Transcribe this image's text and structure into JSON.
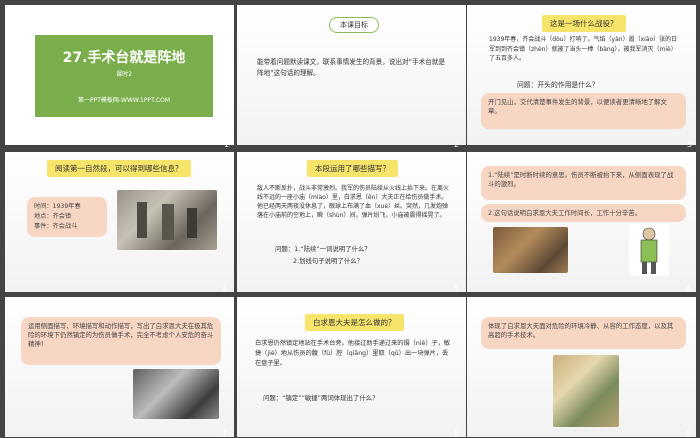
{
  "slides": [
    {
      "id": 1,
      "number": "1",
      "title": "27.手术台就是阵地",
      "subtitle": "课时2",
      "footer": "第一PPT模板网-WWW.1PPT.COM"
    },
    {
      "id": 2,
      "number": "2",
      "pill": "本课目标",
      "text": "能带着问题默读课文，联系事情发生的背景，说出对“手术台就是阵地”这句话的理解。"
    },
    {
      "id": 3,
      "number": "3",
      "pill": "这是一场什么战役？",
      "text": "1939年春，齐会战斗（dòu）打响了。气焰（yàn）嚣（xiāo）张的日军到到齐会镇（zhèn）就被了当头一棒（bàng），被我军消灭（miè）了五百多人。",
      "question": "问题：开头的作用是什么？",
      "answer": "开门见山，交代清楚事件发生的背景，以便读者更清晰地了解文章。"
    },
    {
      "id": 4,
      "number": "4",
      "pill": "阅读第一自然段，可以得到哪些信息？",
      "info": [
        "时间：1939年春",
        "地点：齐会镇",
        "事件：齐会战斗"
      ]
    },
    {
      "id": 5,
      "number": "5",
      "pill": "本段运用了哪些描写？",
      "text": "敌人不断反扑，战斗非常激烈。我军的伤员陆续从火线上抬下来。在离火线不远的一座小庙（miào）里，白求恩（ēn）大夫正在给伤员做手术。他已经两天两夜没休息了，眼球上布满了血（xuè）丝。突然，几发炮弹落在小庙前的空地上，瞬（shùn）间，弹片纷飞，小庙被震得摇晃了。",
      "q1": "问题：1.“陆续”一词说明了什么？",
      "q2": "2.划线句子说明了什么？"
    },
    {
      "id": 6,
      "number": "6",
      "notes": [
        "1.“陆续”是时断时续的意思。伤员不断被抬下来，从侧面表现了战斗的激烈。",
        "2.这句话说明白求恩大夫工作时间长，工作十分辛苦。"
      ]
    },
    {
      "id": 7,
      "number": "7",
      "text": "运用侧面描写、环境描写和动作描写，写出了白求恩大夫在极其危险的环境下仍然镇定的为伤员做手术，完全不考虑个人安危的奋斗精神！"
    },
    {
      "id": 8,
      "number": "8",
      "pill": "白求恩大夫是怎么做的？",
      "text": "白求恩仍然镇定地站在手术台旁。他接过助手递过来的镊（niè）子，敏捷（jié）地从伤员的腹（fù）腔（qiāng）里取（qǔ）出一块弹片，丢在盘子里。",
      "question": "问题：“镇定”“敏捷”两词体现出了什么？"
    },
    {
      "id": 9,
      "number": "9",
      "text": "体现了白求恩大夫面对危险的环境冷静、从容的工作态度，以及其高超的手术技术。"
    }
  ],
  "colors": {
    "background": "#444446",
    "title_slide": "#7aae4a",
    "pill_yellow": "#f7e46b",
    "peach_box": "#f8d6c4",
    "accent_red": "#d33"
  }
}
